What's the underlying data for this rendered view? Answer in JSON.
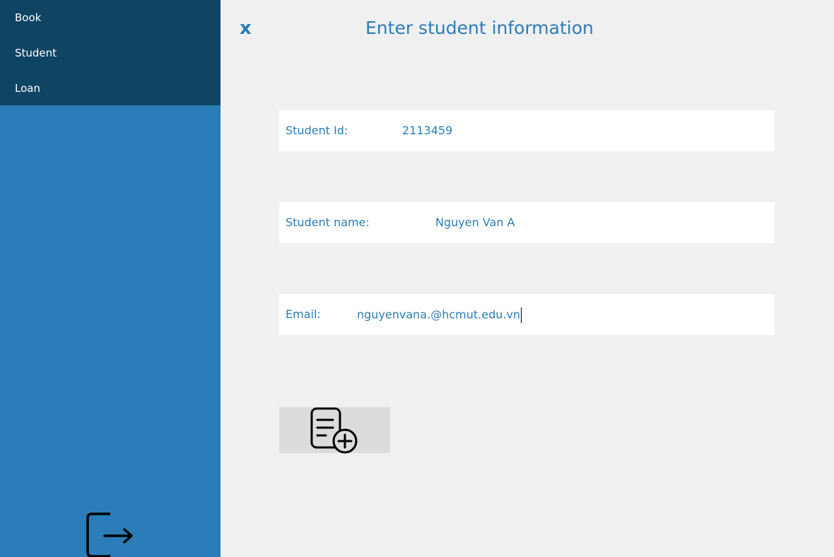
{
  "sidebar": {
    "items": [
      {
        "label": "Book",
        "icon": ""
      },
      {
        "label": "Student",
        "icon": ""
      },
      {
        "label": "Loan",
        "icon": ""
      }
    ],
    "logout_icon": "logout-icon"
  },
  "header": {
    "close_label": "x",
    "title": "Enter student information"
  },
  "form": {
    "student_id": {
      "label": "Student Id:",
      "value": "2113459"
    },
    "student_name": {
      "label": "Student name:",
      "value": "Nguyen Van A"
    },
    "email": {
      "label": "Email:",
      "value": "nguyenvana.@hcmut.edu.vn"
    },
    "add_button_icon": "add-document-icon"
  },
  "colors": {
    "sidebar_dark": "#0f4463",
    "sidebar_blue": "#2a7db8",
    "accent_text": "#2a7db8",
    "background": "#f0f0f0",
    "button_bg": "#dcdcdc"
  }
}
